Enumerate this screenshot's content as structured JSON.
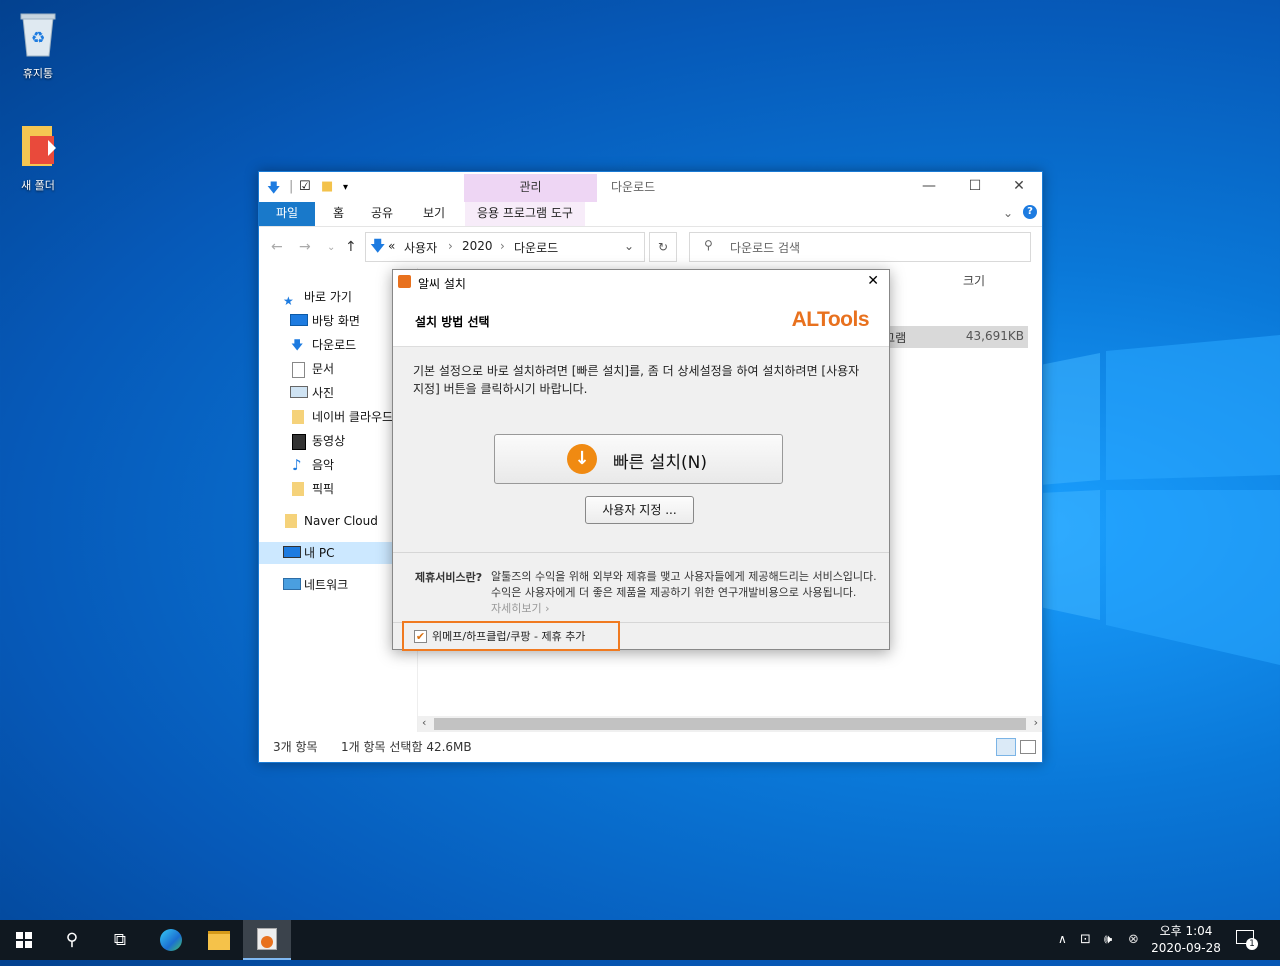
{
  "desktop": {
    "icons": [
      {
        "label": "휴지통"
      },
      {
        "label": "새 폴더"
      }
    ]
  },
  "explorer": {
    "title": "다운로드",
    "context_tab": "관리",
    "ribbon_tabs": [
      "파일",
      "홈",
      "공유",
      "보기",
      "응용 프로그램 도구"
    ],
    "address": {
      "prefix": "«",
      "segments": [
        "사용자",
        "2020",
        "다운로드"
      ]
    },
    "search_placeholder": "다운로드 검색",
    "nav": [
      {
        "label": "바로 가기"
      },
      {
        "label": "바탕 화면"
      },
      {
        "label": "다운로드"
      },
      {
        "label": "문서"
      },
      {
        "label": "사진"
      },
      {
        "label": "네이버 클라우드"
      },
      {
        "label": "동영상"
      },
      {
        "label": "음악"
      },
      {
        "label": "픽픽"
      },
      {
        "label": "Naver Cloud"
      },
      {
        "label": "내 PC"
      },
      {
        "label": "네트워크"
      }
    ],
    "columns": {
      "size": "크기"
    },
    "selected_row": {
      "type_partial": "로그램",
      "size": "43,691KB"
    },
    "status": {
      "count": "3개 항목",
      "selection": "1개 항목 선택함 42.6MB"
    }
  },
  "dialog": {
    "title": "알씨 설치",
    "heading": "설치 방법 선택",
    "brand": "ALTools",
    "description": "기본 설정으로 바로 설치하려면 [빠른 설치]를, 좀 더 상세설정을 하여 설치하려면 [사용자 지정] 버튼을 클릭하시기 바랍니다.",
    "quick_install": "빠른 설치(N)",
    "custom_install": "사용자 지정 ...",
    "partner_key": "제휴서비스란?",
    "partner_text": "알툴즈의 수익을 위해 외부와 제휴를 맺고 사용자들에게 제공해드리는 서비스입니다. 수익은 사용자에게 더 좋은 제품을 제공하기 위한 연구개발비용으로 사용됩니다.",
    "partner_more": "자세히보기 ›",
    "option_label": "위메프/하프클럽/쿠팡 - 제휴 추가",
    "option_checked": true
  },
  "taskbar": {
    "time": "오후 1:04",
    "date": "2020-09-28",
    "notifications": "1"
  },
  "colors": {
    "accent": "#1979ca",
    "brand": "#e8711e",
    "highlight": "#f07a20"
  }
}
